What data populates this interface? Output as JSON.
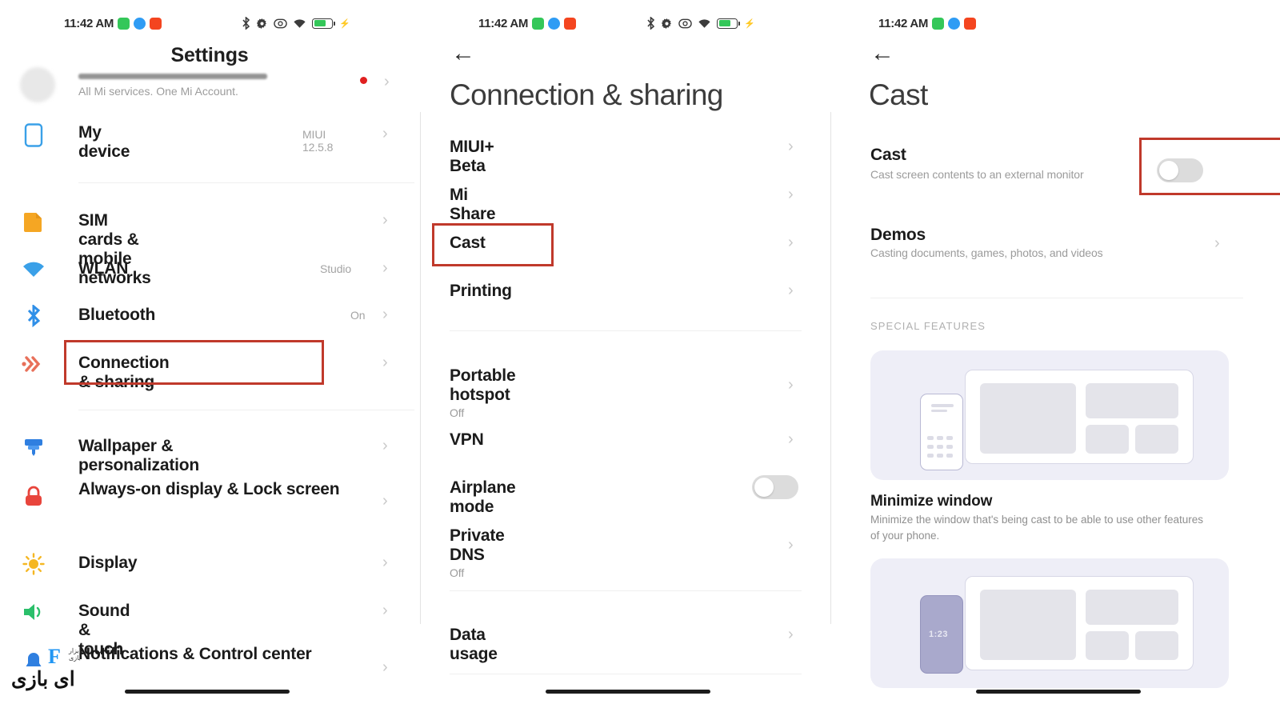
{
  "status_bar": {
    "time": "11:42 AM",
    "indicator_dots": [
      "green",
      "blue",
      "red"
    ],
    "icons": [
      "bluetooth-icon",
      "gear-icon",
      "dnd-icon",
      "wifi-icon",
      "battery-icon",
      "charging-bolt-icon"
    ]
  },
  "panel_settings": {
    "title": "Settings",
    "account_row": {
      "subtitle": "All Mi services. One Mi Account.",
      "has_badge": true
    },
    "items": [
      {
        "label": "My device",
        "value": "MIUI 12.5.8",
        "icon": "device-icon",
        "icon_color": "#3aa0e8"
      },
      {
        "label": "SIM cards & mobile networks",
        "value": "",
        "icon": "sim-card-icon",
        "icon_color": "#f5a623"
      },
      {
        "label": "WLAN",
        "value": "Studio",
        "icon": "wifi-icon",
        "icon_color": "#3aa0e8"
      },
      {
        "label": "Bluetooth",
        "value": "On",
        "icon": "bluetooth-icon",
        "icon_color": "#2f8fe8"
      },
      {
        "label": "Connection & sharing",
        "value": "",
        "icon": "connection-sharing-icon",
        "icon_color": "#e8705a",
        "highlighted": true
      },
      {
        "label": "Wallpaper & personalization",
        "value": "",
        "icon": "wallpaper-brush-icon",
        "icon_color": "#2f7fe0"
      },
      {
        "label": "Always-on display & Lock screen",
        "value": "",
        "icon": "lock-icon",
        "icon_color": "#e8453c"
      },
      {
        "label": "Display",
        "value": "",
        "icon": "brightness-sun-icon",
        "icon_color": "#f5b723"
      },
      {
        "label": "Sound & touch",
        "value": "",
        "icon": "speaker-icon",
        "icon_color": "#2bbf6a"
      },
      {
        "label": "Notifications & Control center",
        "value": "",
        "icon": "notification-bell-icon",
        "icon_color": "#2f7fe0"
      }
    ]
  },
  "panel_connection": {
    "back_icon": "back-arrow-icon",
    "title": "Connection & sharing",
    "group_one": [
      {
        "label": "MIUI+ Beta",
        "sub": "",
        "control": "chevron"
      },
      {
        "label": "Mi Share",
        "sub": "",
        "control": "chevron"
      },
      {
        "label": "Cast",
        "sub": "",
        "control": "chevron",
        "highlighted": true
      },
      {
        "label": "Printing",
        "sub": "",
        "control": "chevron"
      }
    ],
    "group_two": [
      {
        "label": "Portable hotspot",
        "sub": "Off",
        "control": "chevron"
      },
      {
        "label": "VPN",
        "sub": "",
        "control": "chevron"
      },
      {
        "label": "Airplane mode",
        "sub": "",
        "control": "toggle",
        "toggle_on": false
      },
      {
        "label": "Private DNS",
        "sub": "Off",
        "control": "chevron"
      }
    ],
    "group_three": [
      {
        "label": "Data usage",
        "sub": "",
        "control": "chevron"
      }
    ]
  },
  "panel_cast": {
    "back_icon": "back-arrow-icon",
    "title": "Cast",
    "cast_row": {
      "label": "Cast",
      "sub": "Cast screen contents to an external monitor",
      "toggle_on": false,
      "highlighted": true
    },
    "demos_row": {
      "label": "Demos",
      "sub": "Casting documents, games, photos, and videos"
    },
    "section_label": "SPECIAL FEATURES",
    "features": [
      {
        "title": "Minimize window",
        "desc": "Minimize the window that's being cast to be able to use other features of your phone.",
        "illustration": "phone-casting-to-monitor-white"
      },
      {
        "title": "",
        "desc": "",
        "illustration": "phone-casting-to-monitor-purple",
        "phone_time": "1:23"
      }
    ]
  },
  "watermark": {
    "text": "ای بازی",
    "mark": "F",
    "sub": "ابزار\nبازی"
  },
  "colors": {
    "highlight_red": "#c0392b",
    "toggle_off": "#dcdcdc",
    "card_bg": "#eeeef7",
    "accent_blue": "#3aa0e8"
  }
}
